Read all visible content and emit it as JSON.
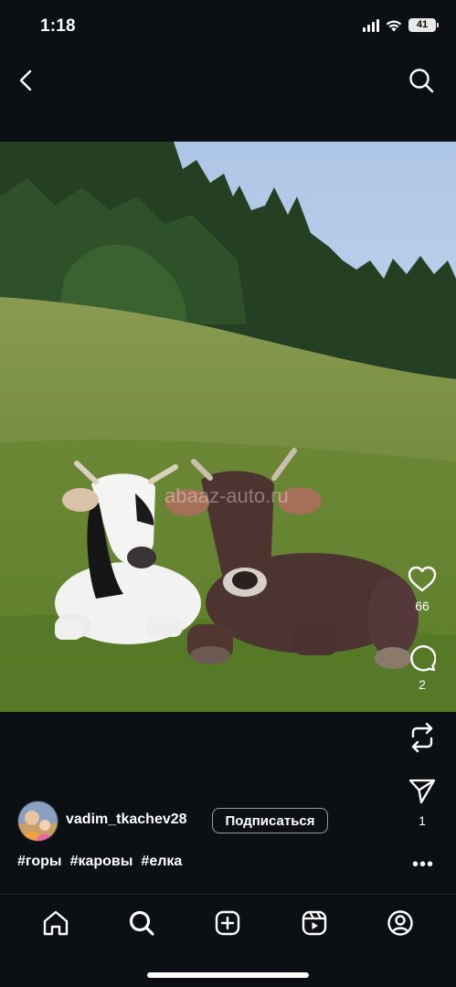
{
  "status_bar": {
    "time": "1:18",
    "battery": "41"
  },
  "header": {
    "back_icon": "chevron-left-icon",
    "search_icon": "search-icon"
  },
  "photo": {
    "watermark": "abaaz-auto.ru"
  },
  "actions": {
    "likes": "66",
    "comments": "2",
    "shares": "1",
    "like_icon": "heart-icon",
    "comment_icon": "comment-icon",
    "repost_icon": "repost-icon",
    "share_icon": "send-icon"
  },
  "post": {
    "username": "vadim_tkachev28",
    "follow_label": "Подписаться",
    "hashtags": [
      "#горы",
      "#каровы",
      "#елка"
    ],
    "more": "•••"
  },
  "nav": {
    "items": [
      "home-icon",
      "search-icon",
      "create-icon",
      "reels-icon",
      "profile-icon"
    ]
  }
}
